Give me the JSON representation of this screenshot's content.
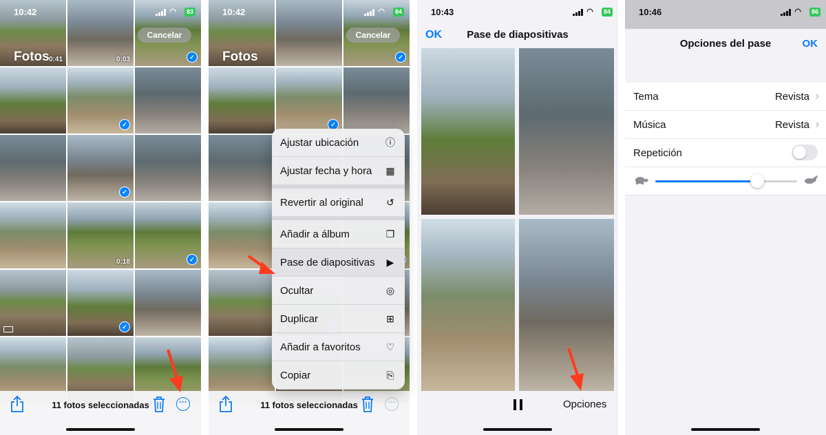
{
  "screens": [
    {
      "status": {
        "time": "10:42",
        "battery": "83"
      },
      "header": {
        "title": "Fotos",
        "cancel_label": "Cancelar"
      },
      "grid": [
        {
          "tone": "t0",
          "duration": "0:41"
        },
        {
          "tone": "t1",
          "duration": "0:03"
        },
        {
          "tone": "t2",
          "check": true
        },
        {
          "tone": "t5"
        },
        {
          "tone": "t3",
          "check": true
        },
        {
          "tone": "t4"
        },
        {
          "tone": "t4"
        },
        {
          "tone": "t1",
          "check": true
        },
        {
          "tone": "t4"
        },
        {
          "tone": "t3"
        },
        {
          "tone": "t2",
          "duration": "0:18"
        },
        {
          "tone": "t2",
          "check": true
        },
        {
          "tone": "t0",
          "panorama": true
        },
        {
          "tone": "t5",
          "check": true
        },
        {
          "tone": "t1"
        },
        {
          "tone": "t3"
        },
        {
          "tone": "t0"
        },
        {
          "tone": "t2"
        }
      ],
      "toolbar": {
        "selection_label": "11 fotos seleccionadas"
      }
    },
    {
      "status": {
        "time": "10:42",
        "battery": "84"
      },
      "header": {
        "title": "Fotos",
        "cancel_label": "Cancelar"
      },
      "toolbar": {
        "selection_label": "11 fotos seleccionadas"
      },
      "menu": [
        {
          "label": "Ajustar ubicación",
          "icon": "location-info-icon"
        },
        {
          "label": "Ajustar fecha y hora",
          "icon": "calendar-clock-icon"
        },
        {
          "label": "Revertir al original",
          "icon": "revert-icon"
        },
        {
          "label": "Añadir a álbum",
          "icon": "add-album-icon"
        },
        {
          "label": "Pase de diapositivas",
          "icon": "slideshow-play-icon"
        },
        {
          "label": "Ocultar",
          "icon": "eye-slash-icon"
        },
        {
          "label": "Duplicar",
          "icon": "duplicate-icon"
        },
        {
          "label": "Añadir a favoritos",
          "icon": "heart-icon"
        },
        {
          "label": "Copiar",
          "icon": "copy-icon"
        }
      ]
    },
    {
      "status": {
        "time": "10:43",
        "battery": "84"
      },
      "header": {
        "ok_label": "OK",
        "title": "Pase de diapositivas"
      },
      "footer": {
        "options_label": "Opciones"
      }
    },
    {
      "status": {
        "time": "10:46",
        "battery": "86"
      },
      "sheet": {
        "title": "Opciones del pase",
        "ok_label": "OK",
        "theme": {
          "label": "Tema",
          "value": "Revista"
        },
        "music": {
          "label": "Música",
          "value": "Revista"
        },
        "repeat": {
          "label": "Repetición",
          "enabled": false
        },
        "speed_fraction": 0.72
      }
    }
  ],
  "colors": {
    "accent": "#0a7aff",
    "highlight_arrow": "#ff3b1f",
    "battery": "#34c759"
  }
}
